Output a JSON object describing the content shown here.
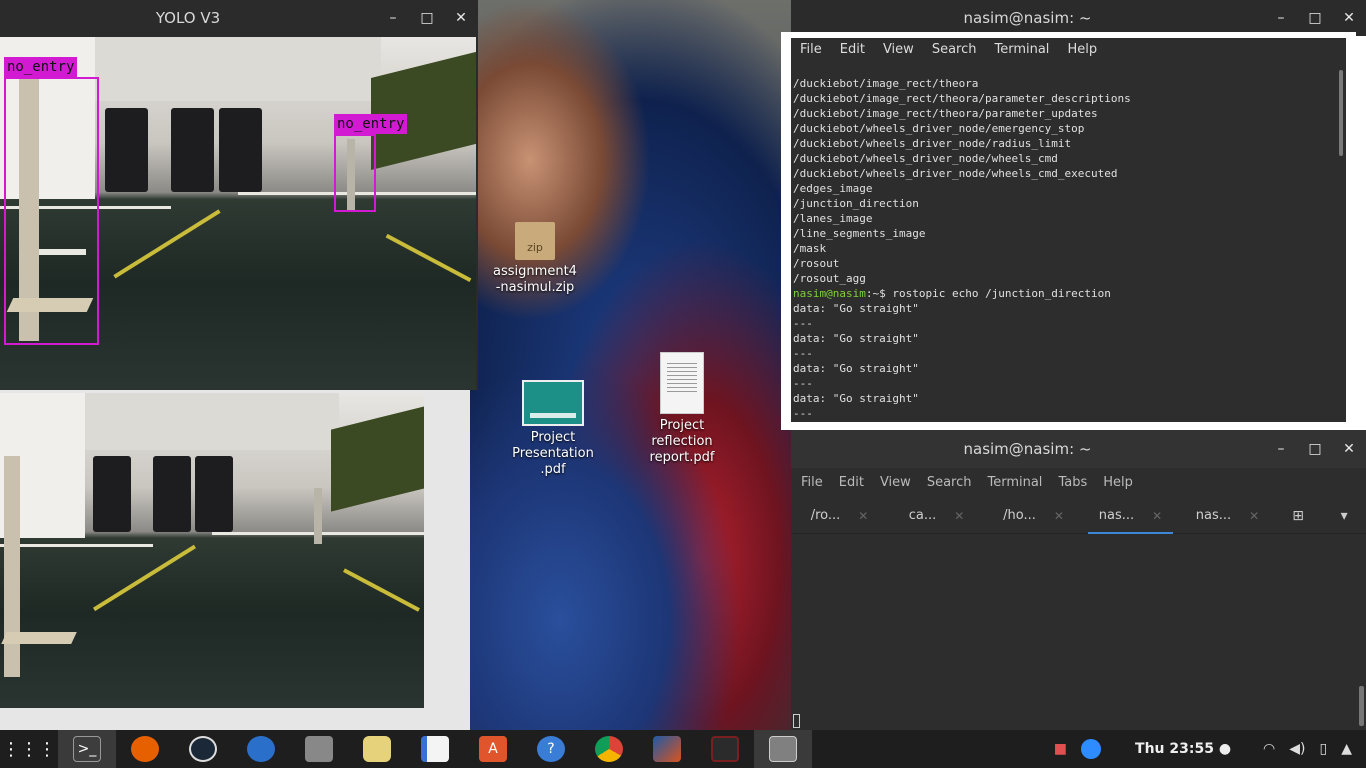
{
  "yolo_window": {
    "title": "YOLO V3",
    "detections": [
      {
        "label": "no_entry"
      },
      {
        "label": "no_entry"
      }
    ]
  },
  "desktop_icons": [
    {
      "label": "assignment4\n-nasimul.zip",
      "icon": "zip-icon",
      "badge": "zip"
    },
    {
      "label": "Project\nPresentation\n.pdf",
      "icon": "pdf-presentation-icon"
    },
    {
      "label": "Project\nreflection\nreport.pdf",
      "icon": "pdf-document-icon"
    }
  ],
  "terminal_top": {
    "title": "nasim@nasim: ~",
    "menu": [
      "File",
      "Edit",
      "View",
      "Search",
      "Terminal",
      "Help"
    ],
    "lines": [
      "/duckiebot/image_rect/theora",
      "/duckiebot/image_rect/theora/parameter_descriptions",
      "/duckiebot/image_rect/theora/parameter_updates",
      "/duckiebot/wheels_driver_node/emergency_stop",
      "/duckiebot/wheels_driver_node/radius_limit",
      "/duckiebot/wheels_driver_node/wheels_cmd",
      "/duckiebot/wheels_driver_node/wheels_cmd_executed",
      "/edges_image",
      "/junction_direction",
      "/lanes_image",
      "/line_segments_image",
      "/mask",
      "/rosout",
      "/rosout_agg"
    ],
    "prompt_user": "nasim@nasim",
    "prompt_suffix": ":~$ rostopic echo /junction_direction",
    "output": [
      "data: \"Go straight\"",
      "---",
      "data: \"Go straight\"",
      "---",
      "data: \"Go straight\"",
      "---",
      "data: \"Go straight\"",
      "---"
    ]
  },
  "terminal_bottom": {
    "title": "nasim@nasim: ~",
    "menu": [
      "File",
      "Edit",
      "View",
      "Search",
      "Terminal",
      "Tabs",
      "Help"
    ],
    "tabs": [
      {
        "label": "/ro...",
        "active": false
      },
      {
        "label": "ca...",
        "active": false
      },
      {
        "label": "/ho...",
        "active": false
      },
      {
        "label": "nas...",
        "active": true
      },
      {
        "label": "nas...",
        "active": false
      }
    ]
  },
  "window_controls": {
    "minimize": "–",
    "maximize": "□",
    "close": "✕"
  },
  "taskbar": {
    "apps": [
      {
        "name": "app-grid",
        "color": "#1e1e1e"
      },
      {
        "name": "terminal",
        "color": "#3a3a3a"
      },
      {
        "name": "firefox",
        "color": "#e66000"
      },
      {
        "name": "steam",
        "color": "#1b2838"
      },
      {
        "name": "thunderbird",
        "color": "#2a6fc9"
      },
      {
        "name": "file-manager",
        "color": "#777777"
      },
      {
        "name": "rhythmbox",
        "color": "#e6d27a"
      },
      {
        "name": "text-editor",
        "color": "#3a6fd8"
      },
      {
        "name": "software-center",
        "color": "#e0552b"
      },
      {
        "name": "help",
        "color": "#3a7dd6"
      },
      {
        "name": "chrome",
        "color": "#2f9e44"
      },
      {
        "name": "matlab",
        "color": "#d9531e"
      },
      {
        "name": "screen-recorder",
        "color": "#7a1f1f"
      },
      {
        "name": "window",
        "color": "#808080"
      }
    ],
    "clock": "Thu 23:55 ●"
  }
}
